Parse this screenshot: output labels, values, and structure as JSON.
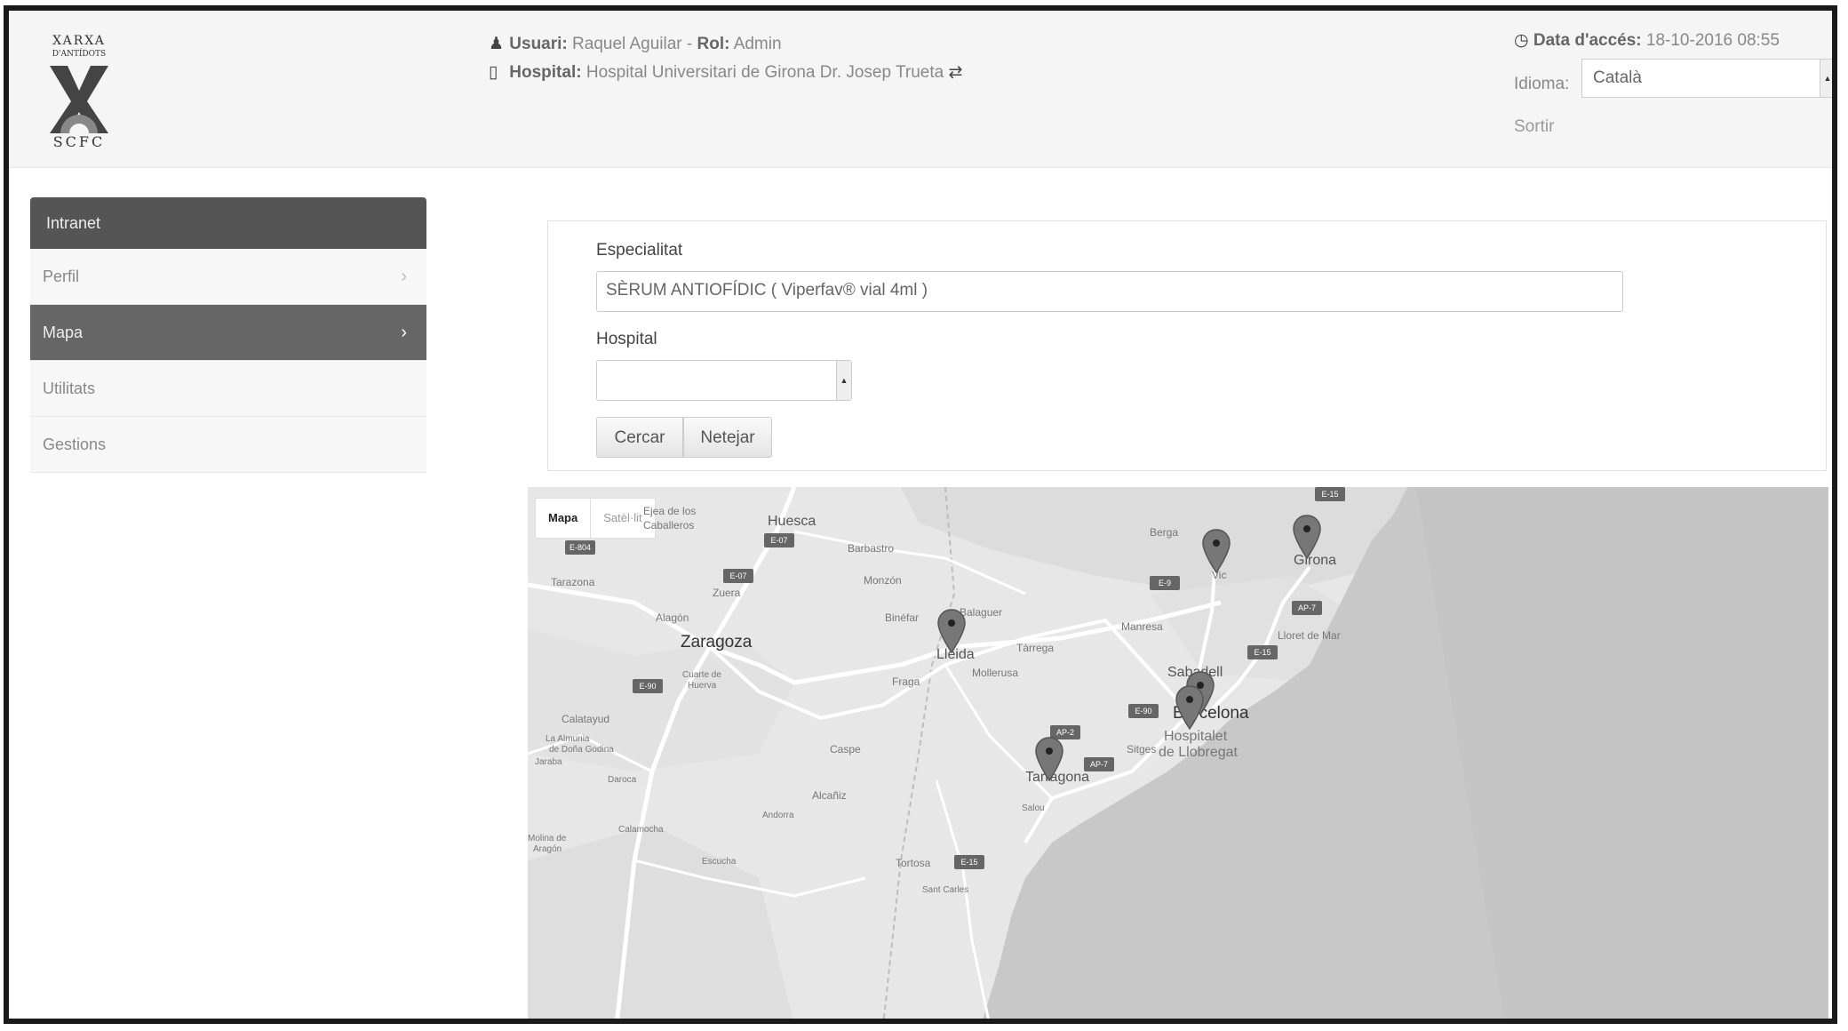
{
  "logo": {
    "line1": "XARXA",
    "line2": "D'ANTÍDOTS",
    "line3": "SCFC"
  },
  "header": {
    "user_label": "Usuari:",
    "user_value": "Raquel Aguilar",
    "role_label": "Rol:",
    "role_value": "Admin",
    "hospital_label": "Hospital:",
    "hospital_value": "Hospital Universitari de Girona Dr. Josep Trueta",
    "access_label": "Data d'accés:",
    "access_value": "18-10-2016 08:55",
    "language_label": "Idioma:",
    "language_value": "Català",
    "logout": "Sortir"
  },
  "sidebar": {
    "title": "Intranet",
    "items": [
      {
        "label": "Perfil",
        "active": false
      },
      {
        "label": "Mapa",
        "active": true
      },
      {
        "label": "Utilitats",
        "active": false
      },
      {
        "label": "Gestions",
        "active": false
      }
    ]
  },
  "form": {
    "specialty_label": "Especialitat",
    "specialty_value": "SÈRUM ANTIOFÍDIC ( Viperfav® vial 4ml )",
    "hospital_label": "Hospital",
    "hospital_value": "",
    "search_button": "Cercar",
    "clear_button": "Netejar"
  },
  "map": {
    "type_map": "Mapa",
    "type_satellite": "Satèl·lit",
    "cities": {
      "ejea": "Ejea de los",
      "ejea2": "Caballeros",
      "huesca": "Huesca",
      "barbastro": "Barbastro",
      "berga": "Berga",
      "vic": "Vic",
      "girona": "Girona",
      "tarazona": "Tarazona",
      "zuera": "Zuera",
      "monzon": "Monzón",
      "binefar": "Binéfar",
      "balaguer": "Balaguer",
      "manresa": "Manresa",
      "lloret": "Lloret de Mar",
      "alagon": "Alagón",
      "zaragoza": "Zaragoza",
      "lleida": "Lleida",
      "tarrega": "Tàrrega",
      "mollerussa": "Mollerusa",
      "fraga": "Fraga",
      "sabadell": "Sabadell",
      "cuarte": "Cuarte de",
      "cuarte2": "Huerva",
      "barcelona": "Barcelona",
      "calatayud": "Calatayud",
      "almunia": "La Almunia",
      "almunia2": "de Doña Godina",
      "jaraba": "Jaraba",
      "hospitalet": "Hospitalet",
      "hospitalet2": "de Llobregat",
      "sitges": "Sitges",
      "caspe": "Caspe",
      "tarragona": "Tarragona",
      "daroca": "Daroca",
      "alcaniz": "Alcañiz",
      "salou": "Salou",
      "andorra": "Andorra",
      "calamocha": "Calamocha",
      "molina": "Molina de",
      "molina2": "Aragón",
      "escucha": "Escucha",
      "tortosa": "Tortosa",
      "sant_carles": "Sant Carles"
    },
    "roads": {
      "r1": "E-804",
      "r2": "E-07",
      "r3": "E-07",
      "r4": "E-9",
      "r5": "AP-7",
      "r6": "E-15",
      "r7": "E-90",
      "r8": "E-90",
      "r9": "AP-2",
      "r10": "AP-7",
      "r11": "E-15",
      "r12": "E-15"
    },
    "markers": [
      "Lleida",
      "Vic",
      "Girona",
      "Barcelona",
      "Barcelona",
      "Tarragona"
    ]
  }
}
